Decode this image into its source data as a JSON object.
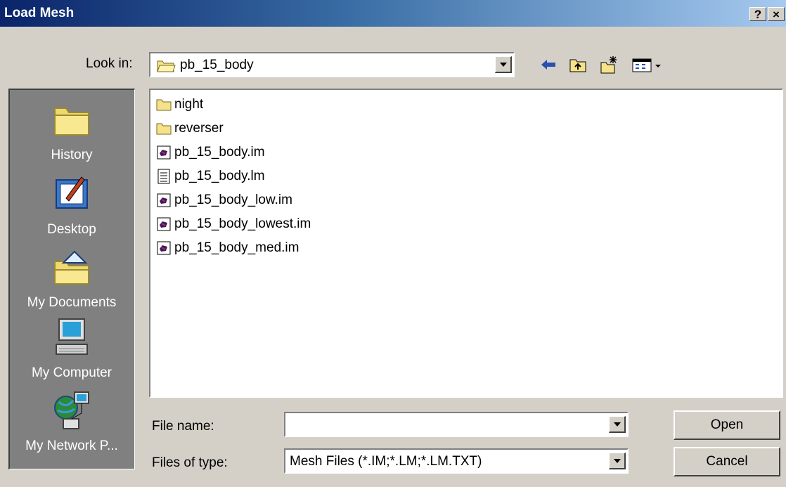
{
  "window": {
    "title": "Load Mesh",
    "help_label": "?",
    "close_label": "×"
  },
  "look_in": {
    "label": "Look in:",
    "value": "pb_15_body"
  },
  "toolbar": {
    "back": "back-icon",
    "up": "up-folder-icon",
    "new_folder": "new-folder-icon",
    "view": "view-menu-icon"
  },
  "places": [
    {
      "label": "History",
      "icon": "history-icon"
    },
    {
      "label": "Desktop",
      "icon": "desktop-icon"
    },
    {
      "label": "My Documents",
      "icon": "my-documents-icon"
    },
    {
      "label": "My Computer",
      "icon": "my-computer-icon"
    },
    {
      "label": "My Network P...",
      "icon": "network-places-icon"
    }
  ],
  "files": [
    {
      "name": "night",
      "type": "folder"
    },
    {
      "name": "reverser",
      "type": "folder"
    },
    {
      "name": "pb_15_body.im",
      "type": "mesh"
    },
    {
      "name": "pb_15_body.lm",
      "type": "text"
    },
    {
      "name": "pb_15_body_low.im",
      "type": "mesh"
    },
    {
      "name": "pb_15_body_lowest.im",
      "type": "mesh"
    },
    {
      "name": "pb_15_body_med.im",
      "type": "mesh"
    }
  ],
  "file_name": {
    "label": "File name:",
    "value": ""
  },
  "file_type": {
    "label": "Files of type:",
    "value": "Mesh Files (*.IM;*.LM;*.LM.TXT)"
  },
  "buttons": {
    "open": "Open",
    "cancel": "Cancel"
  }
}
